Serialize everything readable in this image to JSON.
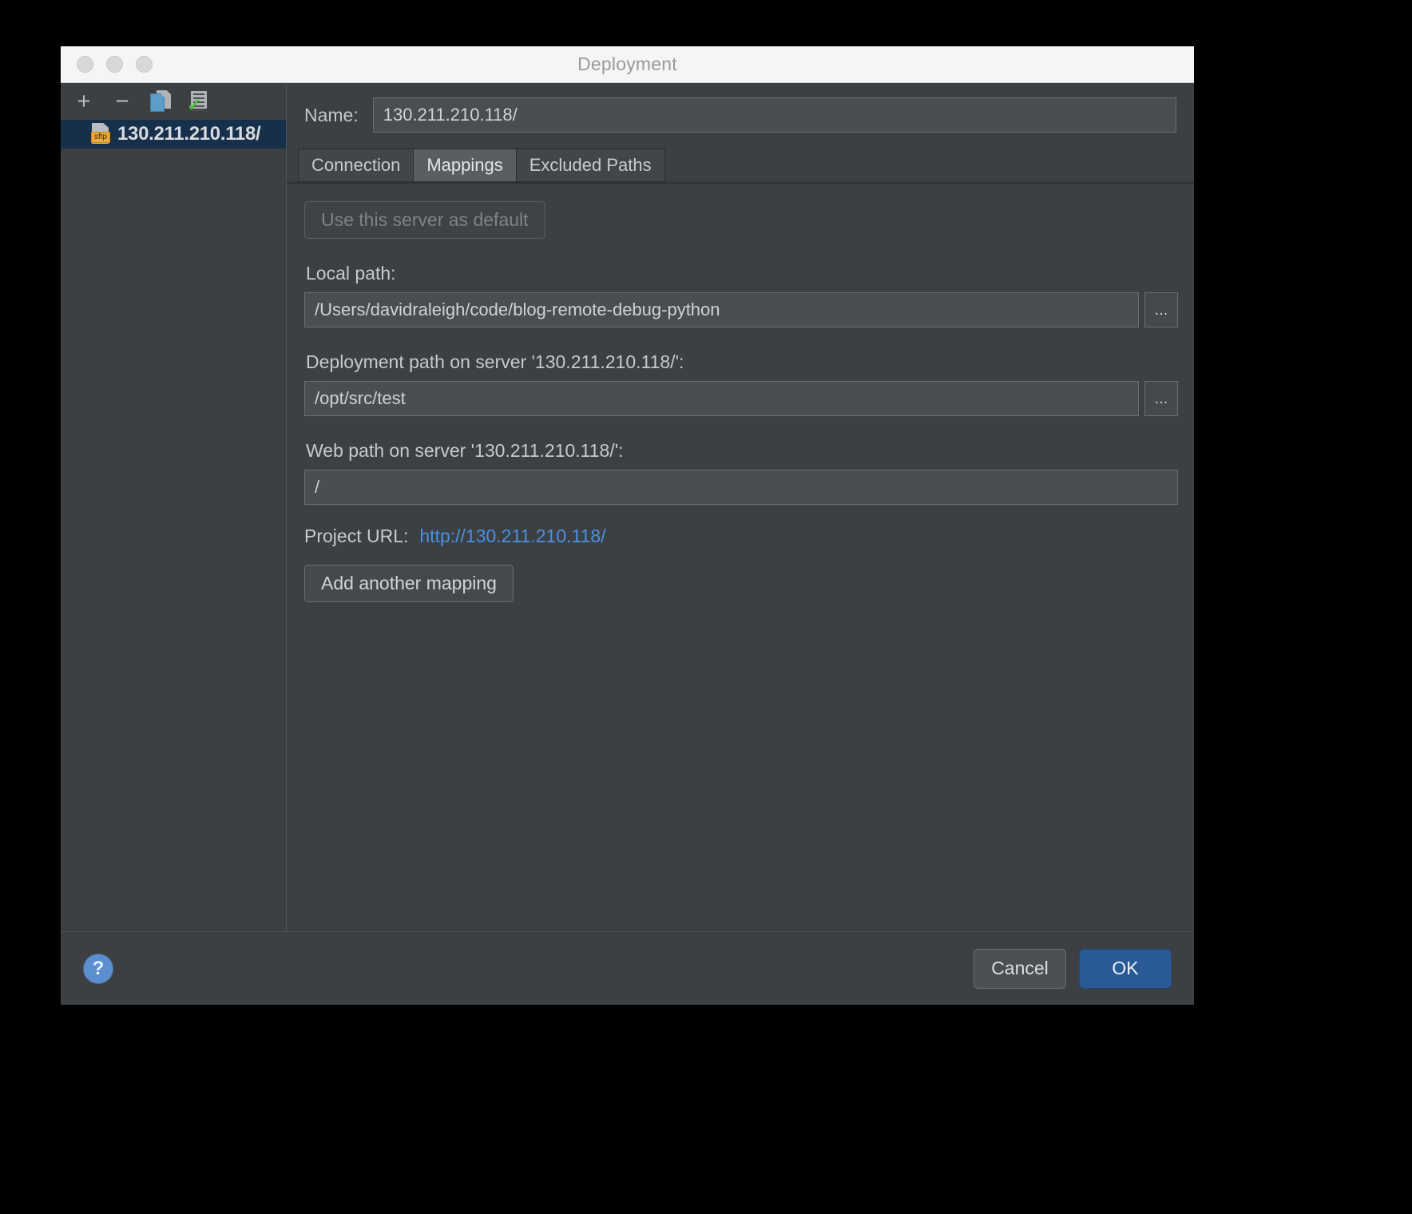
{
  "window": {
    "title": "Deployment",
    "traffic_lights": [
      "close-dot",
      "minimize-dot",
      "zoom-dot"
    ]
  },
  "sidebar": {
    "toolbar": [
      {
        "name": "add-server-button",
        "glyph": "+"
      },
      {
        "name": "remove-server-button",
        "glyph": "−"
      },
      {
        "name": "copy-server-button",
        "glyph": "copy-icon"
      },
      {
        "name": "set-default-server-button",
        "glyph": "server-check-icon"
      }
    ],
    "servers": [
      {
        "label": "130.211.210.118/",
        "badge": "sftp",
        "selected": true
      }
    ]
  },
  "panel": {
    "name_label": "Name:",
    "name_value": "130.211.210.118/",
    "tabs": [
      {
        "label": "Connection",
        "active": false
      },
      {
        "label": "Mappings",
        "active": true
      },
      {
        "label": "Excluded Paths",
        "active": false
      }
    ],
    "use_default_button": "Use this server as default",
    "local_path_label": "Local path:",
    "local_path_value": "/Users/davidraleigh/code/blog-remote-debug-python",
    "deployment_path_label": "Deployment path on server '130.211.210.118/':",
    "deployment_path_value": "/opt/src/test",
    "web_path_label": "Web path on server '130.211.210.118/':",
    "web_path_value": "/",
    "browse_button_label": "...",
    "project_url_label": "Project URL:",
    "project_url_value": "http://130.211.210.118/",
    "add_mapping_button": "Add another mapping"
  },
  "footer": {
    "help_label": "?",
    "cancel_label": "Cancel",
    "ok_label": "OK"
  },
  "colors": {
    "window_bg": "#3c4043",
    "titlebar_bg": "#f5f5f5",
    "selection_bg": "#16304b",
    "link_blue": "#4a90e2",
    "primary_button": "#2a5a96",
    "sftp_badge": "#f0a93b",
    "check_green": "#4fbd3a"
  }
}
